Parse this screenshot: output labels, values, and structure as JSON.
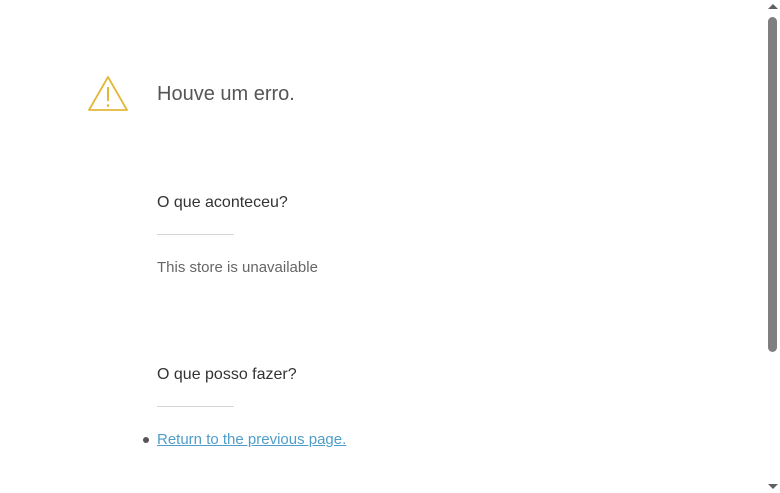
{
  "error": {
    "icon": "warning-icon",
    "icon_color": "#e3b73a",
    "title": "Houve um erro."
  },
  "what_happened": {
    "heading": "O que aconteceu?",
    "message": "This store is unavailable"
  },
  "what_can_i_do": {
    "heading": "O que posso fazer?",
    "actions": [
      {
        "label": "Return to the previous page."
      }
    ]
  },
  "colors": {
    "link": "#4e9ec9",
    "warning": "#e3b73a"
  }
}
